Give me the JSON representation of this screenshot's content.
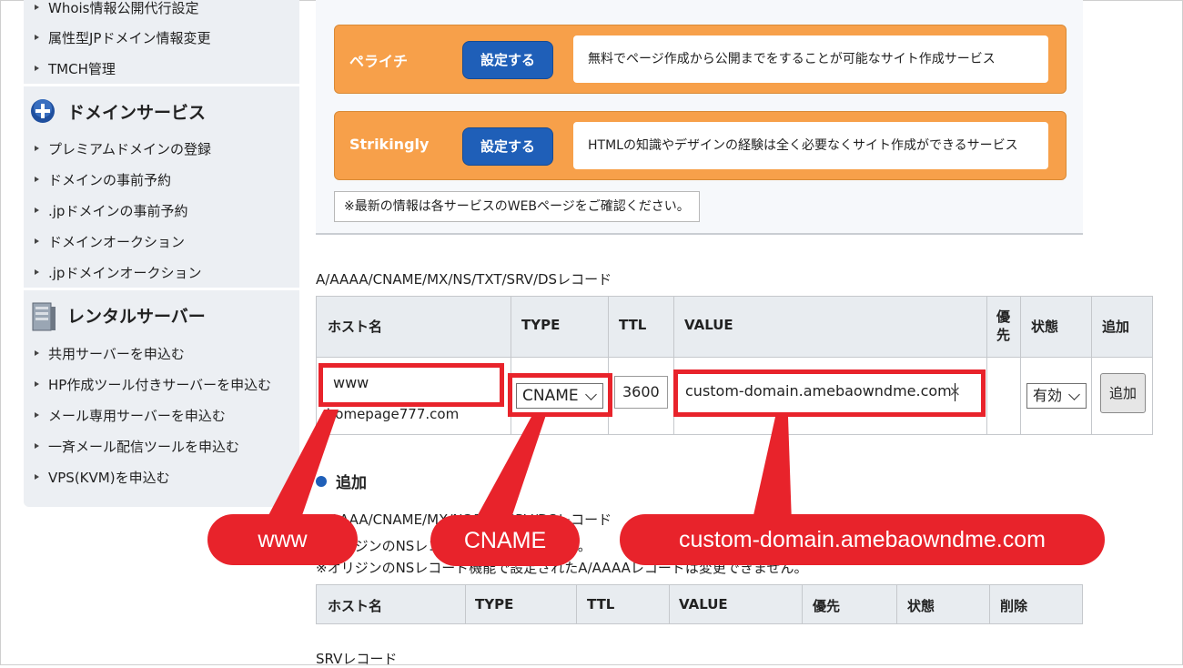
{
  "sidebar": {
    "top_items": [
      "Whois情報公開代行設定",
      "属性型JPドメイン情報変更",
      "TMCH管理"
    ],
    "domain_services": {
      "title": "ドメインサービス",
      "items": [
        "プレミアムドメインの登録",
        "ドメインの事前予約",
        ".jpドメインの事前予約",
        "ドメインオークション",
        ".jpドメインオークション"
      ]
    },
    "rental_server": {
      "title": "レンタルサーバー",
      "items": [
        "共用サーバーを申込む",
        "HP作成ツール付きサーバーを申込む",
        "メール専用サーバーを申込む",
        "一斉メール配信ツールを申込む",
        "VPS(KVM)を申込む"
      ]
    }
  },
  "services": [
    {
      "name": "ペライチ",
      "button": "設定する",
      "description": "無料でページ作成から公開までをすることが可能なサイト作成サービス"
    },
    {
      "name": "Strikingly",
      "button": "設定する",
      "description": "HTMLの知識やデザインの経験は全く必要なくサイト作成ができるサービス"
    }
  ],
  "notice": "※最新の情報は各サービスのWEBページをご確認ください。",
  "records": {
    "section_label": "A/AAAA/CNAME/MX/NS/TXT/SRV/DSレコード",
    "headers": {
      "host": "ホスト名",
      "type": "TYPE",
      "ttl": "TTL",
      "value": "VALUE",
      "priority": "優先",
      "status": "状態",
      "add": "追加"
    },
    "row": {
      "host_value": "www",
      "domain_suffix": ".homepage777.com",
      "type_value": "CNAME",
      "ttl_value": "3600",
      "value_value": "custom-domain.amebaowndme.com",
      "clear_glyph": "×",
      "status_value": "有効",
      "add_button": "追加"
    }
  },
  "added_section": {
    "title": "追加",
    "line1": "A/AAAA/CNAME/MX/NS/TXT/SRV/DSレコード",
    "line2": "※オリジンのNSレコードは変更できません。",
    "line3": "※オリジンのNSレコード機能で設定されたA/AAAAレコードは変更できません。",
    "headers": [
      "ホスト名",
      "TYPE",
      "TTL",
      "VALUE",
      "優先",
      "状態",
      "削除"
    ]
  },
  "srv_label": "SRVレコード",
  "callouts": {
    "host": "www",
    "type": "CNAME",
    "value": "custom-domain.amebaowndme.com"
  }
}
